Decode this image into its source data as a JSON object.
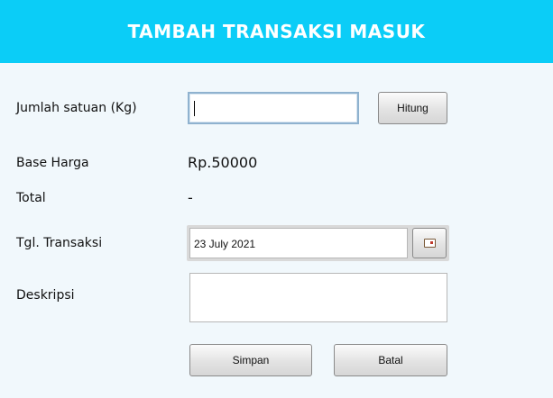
{
  "header": {
    "title": "TAMBAH TRANSAKSI MASUK"
  },
  "form": {
    "jumlah_label": "Jumlah satuan (Kg)",
    "jumlah_value": "",
    "hitung_button": "Hitung",
    "base_harga_label": "Base Harga",
    "base_harga_value": "Rp.50000",
    "total_label": "Total",
    "total_value": "-",
    "tgl_label": "Tgl. Transaksi",
    "tgl_value": "23 July 2021",
    "deskripsi_label": "Deskripsi",
    "deskripsi_value": ""
  },
  "actions": {
    "simpan_button": "Simpan",
    "batal_button": "Batal"
  },
  "colors": {
    "header_bg": "#0bcdf7",
    "page_bg": "#f1f8fc"
  },
  "icons": {
    "date_picker": "calendar-icon"
  }
}
